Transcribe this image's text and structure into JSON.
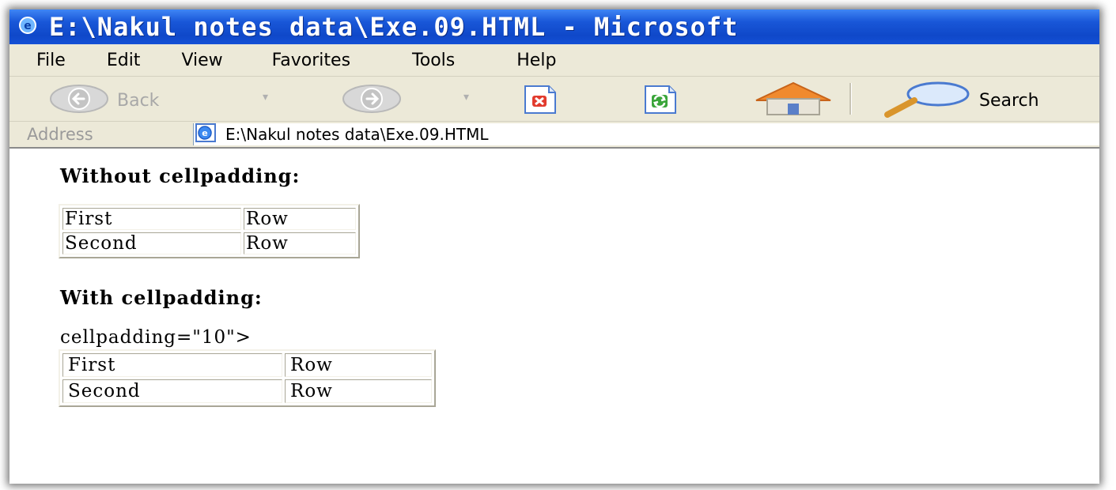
{
  "window": {
    "title": "E:\\Nakul notes data\\Exe.09.HTML - Microsoft"
  },
  "menu": {
    "items": [
      "File",
      "Edit",
      "View",
      "Favorites",
      "Tools",
      "Help"
    ]
  },
  "toolbar": {
    "back_label": "Back",
    "search_label": "Search"
  },
  "address": {
    "label": "Address",
    "value": "E:\\Nakul notes data\\Exe.09.HTML"
  },
  "content": {
    "heading1": "Without cellpadding:",
    "table1": {
      "rows": [
        [
          "First",
          "Row"
        ],
        [
          "Second",
          "Row"
        ]
      ]
    },
    "heading2": "With cellpadding:",
    "stray_text": "cellpadding=\"10\">",
    "table2": {
      "rows": [
        [
          "First",
          "Row"
        ],
        [
          "Second",
          "Row"
        ]
      ]
    }
  },
  "colors": {
    "titlebar": "#1957d8",
    "chrome": "#ece9d8"
  }
}
